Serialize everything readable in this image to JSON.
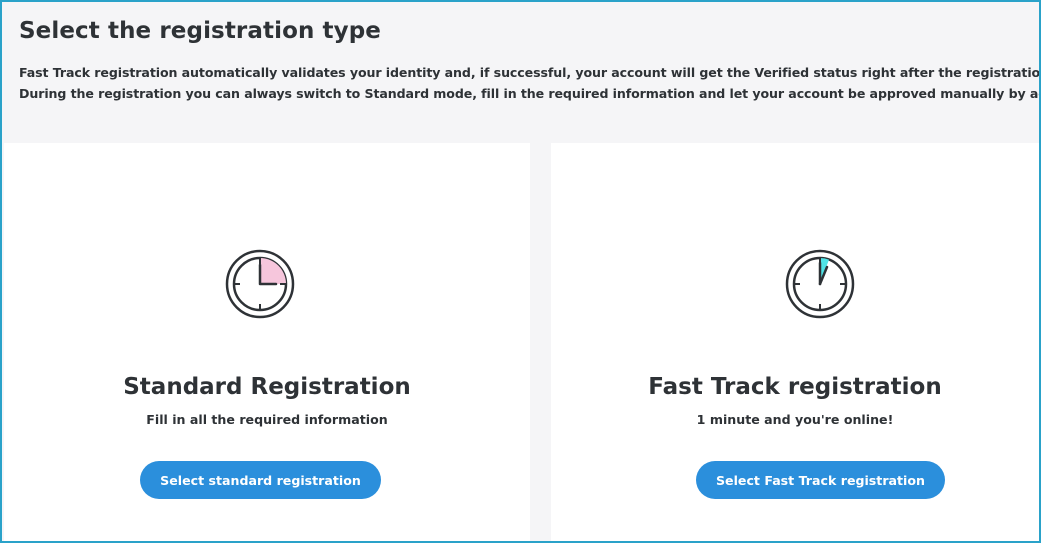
{
  "page": {
    "title": "Select the registration type",
    "description_line1": "Fast Track registration automatically validates your identity and, if successful, your account will get the Verified status right after the registration is completed.",
    "description_line2": "During the registration you can always switch to Standard mode, fill in the required information and let your account be approved manually by administrator."
  },
  "standard": {
    "title": "Standard Registration",
    "subtitle": "Fill in all the required information",
    "button_label": "Select standard registration",
    "icon": "clock-quarter-icon",
    "accent_color": "#f6c6dc"
  },
  "fast_track": {
    "title": "Fast Track registration",
    "subtitle": "1 minute and you're online!",
    "button_label": "Select Fast Track registration",
    "icon": "clock-minute-icon",
    "accent_color": "#4fe3e6"
  },
  "colors": {
    "button": "#2b8fdc",
    "frame_border": "#2aa2c9",
    "background": "#f5f5f7"
  }
}
